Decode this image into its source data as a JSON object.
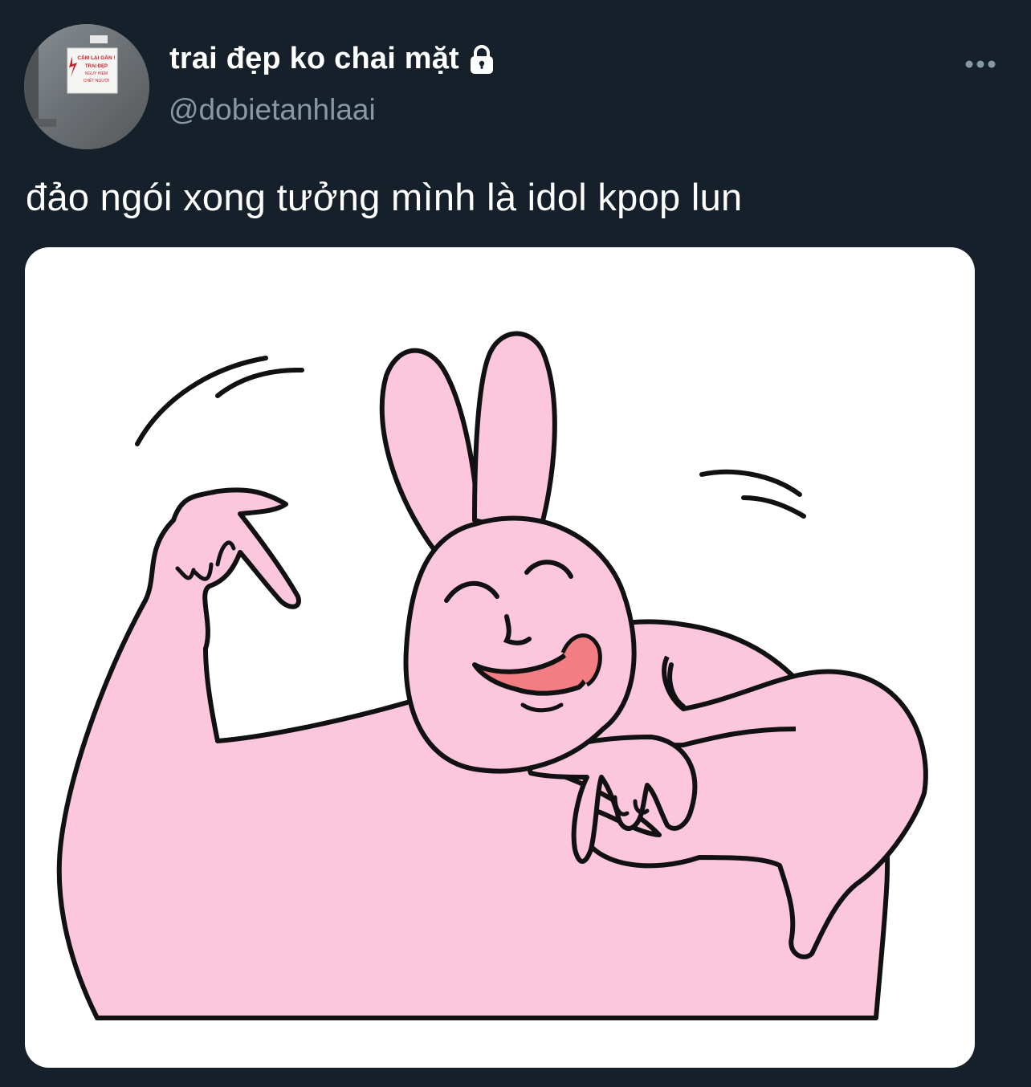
{
  "author": {
    "display_name": "trai đẹp ko chai mặt",
    "handle": "@dobietanhlaai",
    "protected_account_icon": "lock-icon"
  },
  "avatar_sign": {
    "icon": "lightning-icon",
    "line1": "CẤM LẠI GẦN !",
    "line2": "TRAI ĐẸP",
    "line3": "NGUY HIỂM",
    "line4": "CHẾT NGƯỜI"
  },
  "tweet": {
    "text": "đảo ngói xong tưởng mình là idol kpop lun"
  },
  "menu": {
    "more_icon": "ellipsis-icon"
  },
  "media": {
    "type": "image",
    "illustration": "pink-rabbit-dancing"
  },
  "colors": {
    "background": "#15202b",
    "secondary_text": "#8899a6",
    "rabbit_pink": "#fcc6dc",
    "tongue": "#f27e84"
  }
}
